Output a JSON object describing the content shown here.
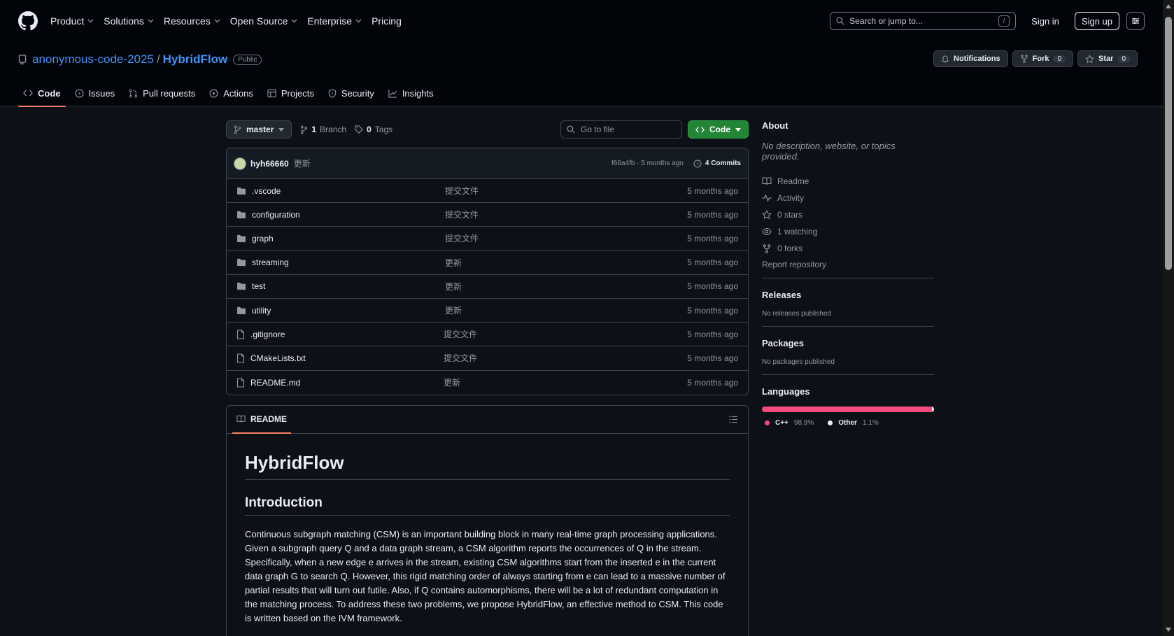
{
  "header": {
    "nav": [
      "Product",
      "Solutions",
      "Resources",
      "Open Source",
      "Enterprise",
      "Pricing"
    ],
    "search_placeholder": "Search or jump to...",
    "search_shortcut": "/",
    "sign_in": "Sign in",
    "sign_up": "Sign up"
  },
  "repo": {
    "owner": "anonymous-code-2025",
    "separator": "/",
    "name": "HybridFlow",
    "visibility": "Public",
    "notifications": "Notifications",
    "fork_label": "Fork",
    "fork_count": "0",
    "star_label": "Star",
    "star_count": "0",
    "tabs": [
      "Code",
      "Issues",
      "Pull requests",
      "Actions",
      "Projects",
      "Security",
      "Insights"
    ]
  },
  "toolbar": {
    "branch": "master",
    "branches_count": "1",
    "branches_label": "Branch",
    "tags_count": "0",
    "tags_label": "Tags",
    "go_to_file": "Go to file",
    "code_button": "Code"
  },
  "commit": {
    "user": "hyh66660",
    "message": "更新",
    "hash_time": "f66a4fb · 5 months ago",
    "commits": "4 Commits"
  },
  "files": [
    {
      "type": "dir",
      "name": ".vscode",
      "msg": "提交文件",
      "time": "5 months ago"
    },
    {
      "type": "dir",
      "name": "configuration",
      "msg": "提交文件",
      "time": "5 months ago"
    },
    {
      "type": "dir",
      "name": "graph",
      "msg": "提交文件",
      "time": "5 months ago"
    },
    {
      "type": "dir",
      "name": "streaming",
      "msg": "更新",
      "time": "5 months ago"
    },
    {
      "type": "dir",
      "name": "test",
      "msg": "更新",
      "time": "5 months ago"
    },
    {
      "type": "dir",
      "name": "utility",
      "msg": "更新",
      "time": "5 months ago"
    },
    {
      "type": "file",
      "name": ".gitignore",
      "msg": "提交文件",
      "time": "5 months ago"
    },
    {
      "type": "file",
      "name": "CMakeLists.txt",
      "msg": "提交文件",
      "time": "5 months ago"
    },
    {
      "type": "file",
      "name": "README.md",
      "msg": "更新",
      "time": "5 months ago"
    }
  ],
  "readme": {
    "tab": "README",
    "h1": "HybridFlow",
    "h2": "Introduction",
    "paragraph": "Continuous subgraph matching (CSM) is an important building block in many real-time graph processing applications. Given a subgraph query Q and a data graph stream, a CSM algorithm reports the occurrences of Q in the stream. Specifically, when a new edge e arrives in the stream, existing CSM algorithms start from the inserted e in the current data graph G to search Q. However, this rigid matching order of always starting from e can lead to a massive number of partial results that will turn out futile. Also, if Q contains automorphisms, there will be a lot of redundant computation in the matching process. To address these two problems, we propose HybridFlow, an effective method to CSM. This code is written based on the IVM framework."
  },
  "about": {
    "title": "About",
    "description": "No description, website, or topics provided.",
    "links": [
      "Readme",
      "Activity",
      "0 stars",
      "1 watching",
      "0 forks"
    ],
    "report": "Report repository",
    "releases_title": "Releases",
    "releases_text": "No releases published",
    "packages_title": "Packages",
    "packages_text": "No packages published",
    "languages_title": "Languages",
    "languages": [
      {
        "name": "C++",
        "percent": "98.9%",
        "value": 98.9,
        "color": "#f34b7d"
      },
      {
        "name": "Other",
        "percent": "1.1%",
        "value": 1.1,
        "color": "#ededed"
      }
    ]
  }
}
